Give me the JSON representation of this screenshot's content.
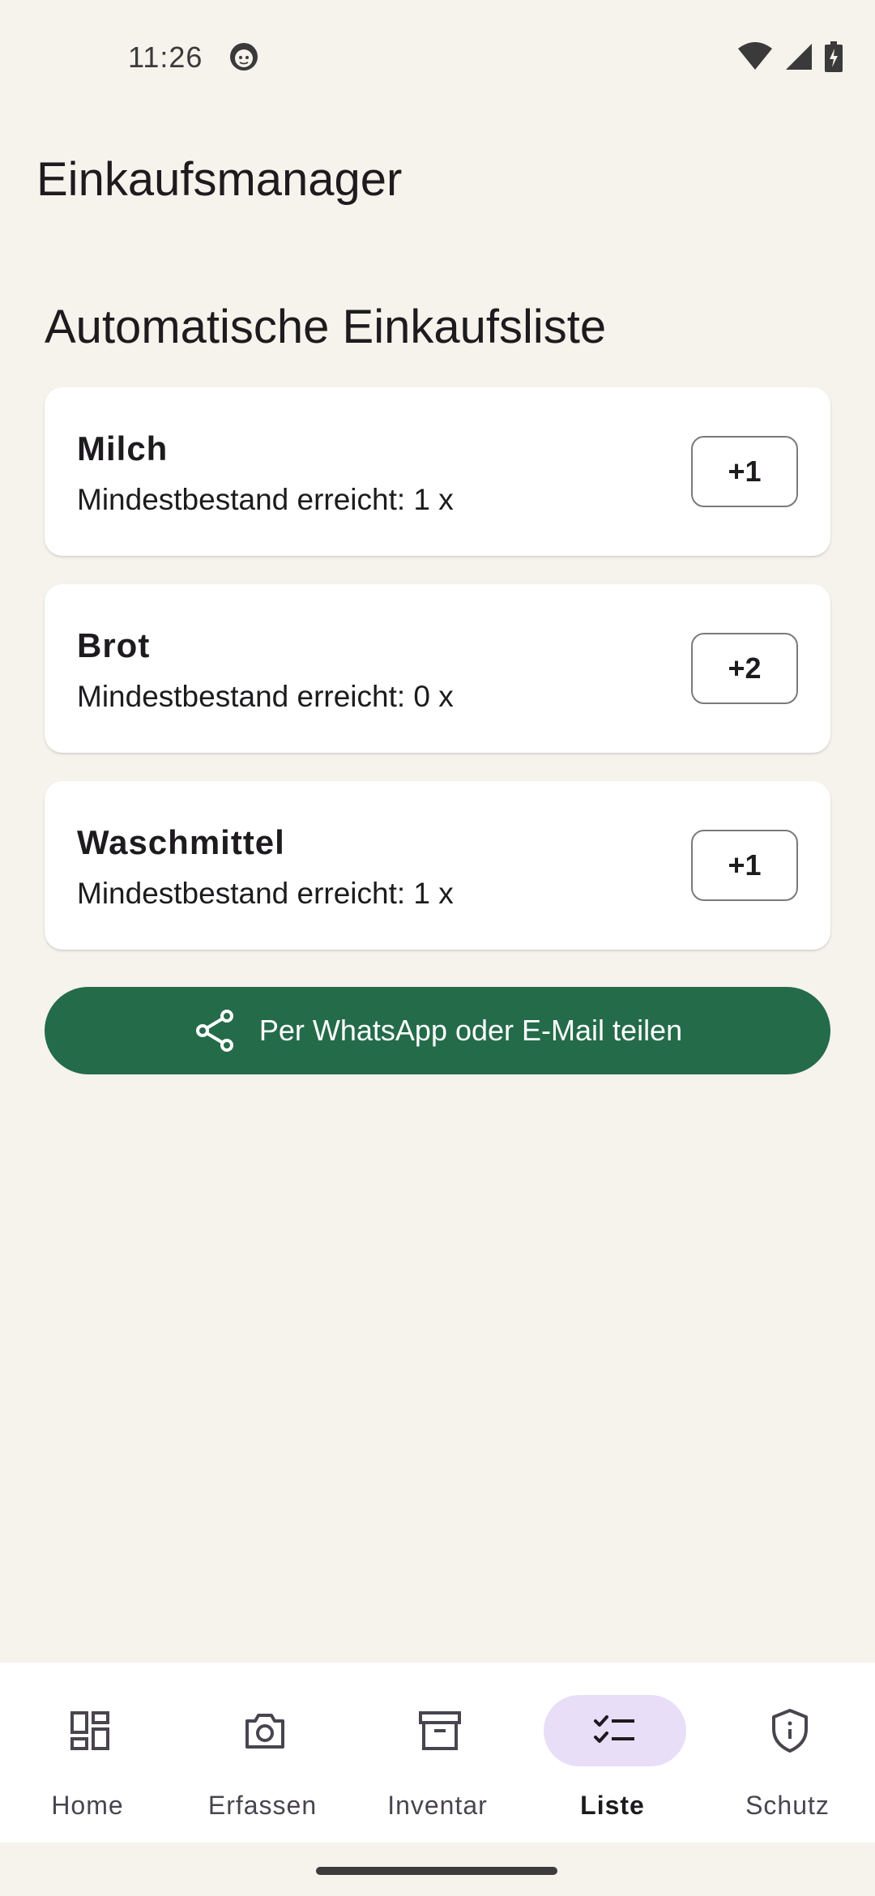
{
  "status_bar": {
    "time": "11:26"
  },
  "app_bar": {
    "title": "Einkaufsmanager"
  },
  "section": {
    "title": "Automatische Einkaufsliste"
  },
  "items": [
    {
      "name": "Milch",
      "subtitle": "Mindestbestand erreicht: 1 x",
      "button": "+1"
    },
    {
      "name": "Brot",
      "subtitle": "Mindestbestand erreicht: 0 x",
      "button": "+2"
    },
    {
      "name": "Waschmittel",
      "subtitle": "Mindestbestand erreicht: 1 x",
      "button": "+1"
    }
  ],
  "share_button": {
    "label": "Per WhatsApp oder E-Mail teilen",
    "icon": "share-icon",
    "color": "#246b4a"
  },
  "nav": {
    "active": "Liste",
    "items": [
      {
        "label": "Home",
        "icon": "dashboard-icon"
      },
      {
        "label": "Erfassen",
        "icon": "camera-icon"
      },
      {
        "label": "Inventar",
        "icon": "archive-icon"
      },
      {
        "label": "Liste",
        "icon": "checklist-icon"
      },
      {
        "label": "Schutz",
        "icon": "shield-icon"
      }
    ]
  },
  "colors": {
    "background": "#f6f2ec",
    "accent": "#246b4a",
    "nav_active_pill": "#e8def8"
  }
}
